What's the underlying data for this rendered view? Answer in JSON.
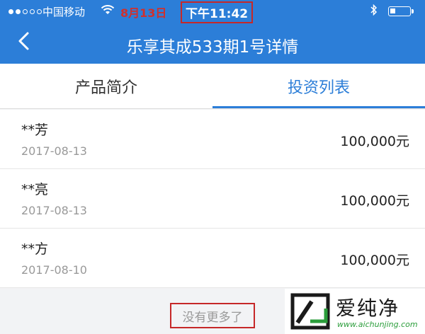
{
  "status_bar": {
    "signal_dots_filled": 2,
    "signal_dots_total": 5,
    "carrier": "中国移动",
    "wifi_icon": "wifi-icon",
    "annotation_date": "8月13日",
    "time": "下午11:42",
    "bluetooth_icon": "bluetooth-icon",
    "battery_icon": "battery-icon"
  },
  "header": {
    "back_icon": "chevron-left-icon",
    "title": "乐享其成533期1号详情",
    "background_color": "#2c7ed8"
  },
  "tabs": [
    {
      "label": "产品简介",
      "active": false
    },
    {
      "label": "投资列表",
      "active": true
    }
  ],
  "investments": [
    {
      "name": "**芳",
      "date": "2017-08-13",
      "amount": "100,000元"
    },
    {
      "name": "**亮",
      "date": "2017-08-13",
      "amount": "100,000元"
    },
    {
      "name": "**方",
      "date": "2017-08-10",
      "amount": "100,000元"
    }
  ],
  "footer": {
    "no_more": "没有更多了"
  },
  "watermark": {
    "text": "爱纯净",
    "url": "www.aichunjing.com"
  },
  "colors": {
    "accent": "#2c7ed8",
    "annotation_red": "#c62828"
  }
}
